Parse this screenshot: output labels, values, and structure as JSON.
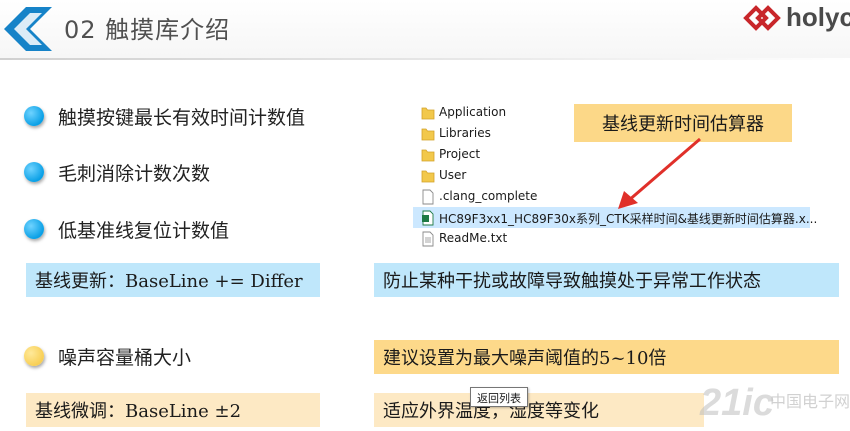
{
  "header": {
    "title": "02 触摸库介绍",
    "logo_text": "holyc",
    "accent": "#1683c8"
  },
  "bullets": [
    {
      "icon": "blue-bullet-icon",
      "text": "触摸按键最长有效时间计数值"
    },
    {
      "icon": "blue-bullet-icon",
      "text": "毛刺消除计数次数"
    },
    {
      "icon": "blue-bullet-icon",
      "text": "低基准线复位计数值"
    },
    {
      "icon": "yellow-bullet-icon",
      "text": "噪声容量桶大小"
    }
  ],
  "boxes": {
    "baseline_update": "基线更新：BaseLine += Differ",
    "anti_interference": "防止某种干扰或故障导致触摸处于异常工作状态",
    "noise_suggestion": "建议设置为最大噪声阈值的5~10倍",
    "baseline_trim": "基线微调：BaseLine ±2",
    "env_adapt": "适应外界温度，湿度等变化"
  },
  "file_list": {
    "items": [
      {
        "name": "Application",
        "icon": "folder-icon"
      },
      {
        "name": "Libraries",
        "icon": "folder-icon"
      },
      {
        "name": "Project",
        "icon": "folder-icon"
      },
      {
        "name": "User",
        "icon": "folder-icon"
      },
      {
        "name": ".clang_complete",
        "icon": "file-icon"
      },
      {
        "name": "HC89F3xx1_HC89F30x系列_CTK采样时间&基线更新时间估算器.x...",
        "icon": "excel-icon",
        "selected": true
      },
      {
        "name": "ReadMe.txt",
        "icon": "text-file-icon"
      }
    ]
  },
  "callout": "基线更新时间估算器",
  "tooltip": "返回列表",
  "watermark": "21ic",
  "watermark_sub": "中国电子网",
  "colors": {
    "bullet_blue": "#0aa0e6",
    "bullet_yellow": "#f8cf55",
    "box_blue": "#bfe7fb",
    "box_yellow": "#fdd98a",
    "box_beige": "#fde9c4",
    "arrow_red": "#e0302a",
    "selection": "#cce8ff"
  }
}
